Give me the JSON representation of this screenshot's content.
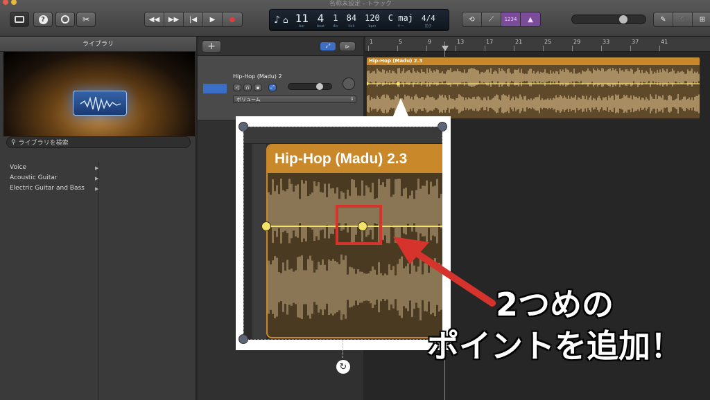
{
  "window": {
    "title": "名称未設定 - トラック"
  },
  "toolbar": {
    "transport": {
      "rewind": "◀◀",
      "forward": "▶▶",
      "to_start": "|◀",
      "play": "▶",
      "record": "●"
    },
    "lcd": {
      "bar": "11",
      "beat": "4",
      "div": "1",
      "tick": "84",
      "bpm": "120",
      "key": "C maj",
      "sig": "4/4",
      "label_bar": "bar",
      "label_beat": "beat",
      "label_div": "div",
      "label_tick": "tick",
      "label_bpm": "bpm",
      "label_key": "キー",
      "label_sig": "拍子"
    },
    "count_in": "1234"
  },
  "library": {
    "title": "ライブラリ",
    "search_placeholder": "ライブラリを検索",
    "categories": [
      {
        "label": "Voice"
      },
      {
        "label": "Acoustic Guitar"
      },
      {
        "label": "Electric Guitar and Bass"
      }
    ]
  },
  "track_header": {
    "add_label": "+"
  },
  "track": {
    "name": "Hip-Hop (Madu) 2",
    "automation_param": "ボリューム"
  },
  "ruler": {
    "bars": [
      "1",
      "5",
      "9",
      "13",
      "17",
      "21",
      "25",
      "29",
      "33",
      "37",
      "41"
    ]
  },
  "region": {
    "name": "Hip-Hop (Madu) 2.3"
  },
  "zoom": {
    "region_name": "Hip-Hop (Madu) 2.3"
  },
  "annotation": {
    "line1": "2つめの",
    "line2": "ポイントを追加！"
  },
  "colors": {
    "region_header": "#c9882a",
    "automation_line": "#f3e36a",
    "highlight_box": "#d6332c",
    "lcd_bg": "#1d2733"
  }
}
